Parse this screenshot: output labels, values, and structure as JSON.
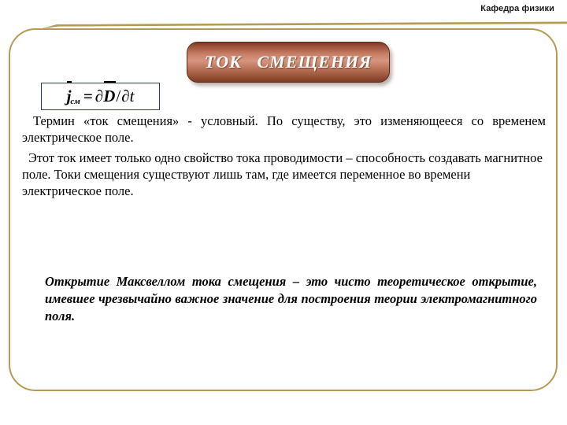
{
  "header": {
    "department": "Кафедра физики"
  },
  "title": {
    "banner_text": "ТОК   СМЕЩЕНИЯ"
  },
  "formula": {
    "symbol_current": "j",
    "subscript": "см",
    "equals": "=",
    "partial_1": "∂",
    "symbol_d": "D",
    "slash": "/",
    "partial_2": "∂",
    "symbol_t": "t",
    "plain": "j_см = ∂D/∂t"
  },
  "body": {
    "paragraph_1": "Термин «ток смещения» - условный. По существу, это изменяющееся со временем электрическое поле.",
    "paragraph_2": "Этот ток имеет только одно свойство тока проводимости – способность создавать магнитное поле. Токи смещения существуют лишь там, где имеется переменное во времени электрическое поле."
  },
  "conclusion": {
    "text": "Открытие Максвеллом тока смещения – это чисто теоретическое открытие, имевшее чрезвычайно важное значение для построения теории электромагнитного поля."
  },
  "colors": {
    "frame_border": "#b49a54",
    "gold_rule": "#b59b56",
    "banner_gradient_light": "#d69681",
    "banner_gradient_dark": "#7b3a25",
    "banner_border": "#5a2a1a",
    "banner_text": "#ffffff",
    "formula_border": "#2b3f63",
    "text": "#000000",
    "background": "#ffffff"
  }
}
